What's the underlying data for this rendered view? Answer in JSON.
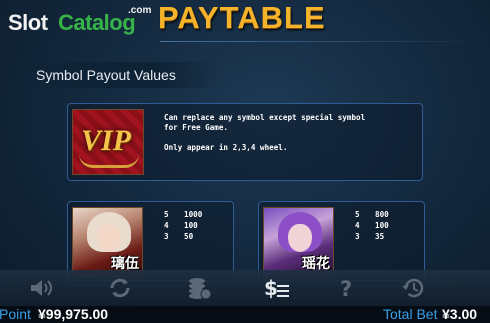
{
  "logo": {
    "slot": "Slot",
    "catalog": "Catalog",
    "com": ".com"
  },
  "title": "PAYTABLE",
  "section_label": "Symbol Payout Values",
  "wild": {
    "icon": "vip-symbol",
    "vip_text": "VIP",
    "lines": [
      "Can replace any symbol except special symbol",
      "for Free Game.",
      "",
      "Only appear in 2,3,4 wheel."
    ]
  },
  "symbols": [
    {
      "icon": "character-blonde-symbol",
      "name": "璃伍",
      "payouts": [
        {
          "count": "5",
          "value": "1000"
        },
        {
          "count": "4",
          "value": "100"
        },
        {
          "count": "3",
          "value": "50"
        }
      ]
    },
    {
      "icon": "character-purple-symbol",
      "name": "瑶花",
      "payouts": [
        {
          "count": "5",
          "value": "800"
        },
        {
          "count": "4",
          "value": "100"
        },
        {
          "count": "3",
          "value": "35"
        }
      ]
    }
  ],
  "toolbar": [
    {
      "icon": "speaker-icon",
      "active": false
    },
    {
      "icon": "autoplay-icon",
      "active": false
    },
    {
      "icon": "coins-icon",
      "active": false
    },
    {
      "icon": "paytable-icon",
      "active": true
    },
    {
      "icon": "help-icon",
      "active": false
    },
    {
      "icon": "history-icon",
      "active": false
    }
  ],
  "status": {
    "point_label": "Point",
    "point_value": "¥99,975.00",
    "bet_label": "Total Bet",
    "bet_value": "¥3.00"
  },
  "colors": {
    "title": "#f4b32a",
    "panel_border": "#2f5c94",
    "status_label": "#3aa0e8",
    "brand_green": "#37b34a"
  }
}
